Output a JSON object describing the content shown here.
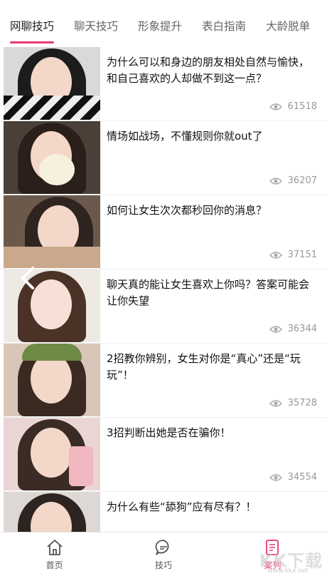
{
  "tabs": [
    {
      "label": "网聊技巧",
      "active": true
    },
    {
      "label": "聊天技巧",
      "active": false
    },
    {
      "label": "形象提升",
      "active": false
    },
    {
      "label": "表白指南",
      "active": false
    },
    {
      "label": "大龄脱单",
      "active": false
    }
  ],
  "articles": [
    {
      "title": "为什么可以和身边的朋友相处自然与愉快，和自己喜欢的人却做不到这一点？",
      "views": "61518"
    },
    {
      "title": "情场如战场，不懂规则你就out了",
      "views": "36207"
    },
    {
      "title": "如何让女生次次都秒回你的消息？",
      "views": "37151"
    },
    {
      "title": "聊天真的能让女生喜欢上你吗？答案可能会让你失望",
      "views": "36344"
    },
    {
      "title": "2招教你辨别，女生对你是“真心”还是“玩玩”！",
      "views": "35728"
    },
    {
      "title": "3招判断出她是否在骗你！",
      "views": "34554"
    },
    {
      "title": "为什么有些“舔狗”应有尽有？！",
      "views": ""
    }
  ],
  "nav": {
    "home_label": "首页",
    "tips_label": "技巧",
    "cases_label": "案列"
  },
  "watermark": {
    "text": "KK下载",
    "url": "www.kkx.net"
  },
  "colors": {
    "accent": "#e8387a"
  }
}
